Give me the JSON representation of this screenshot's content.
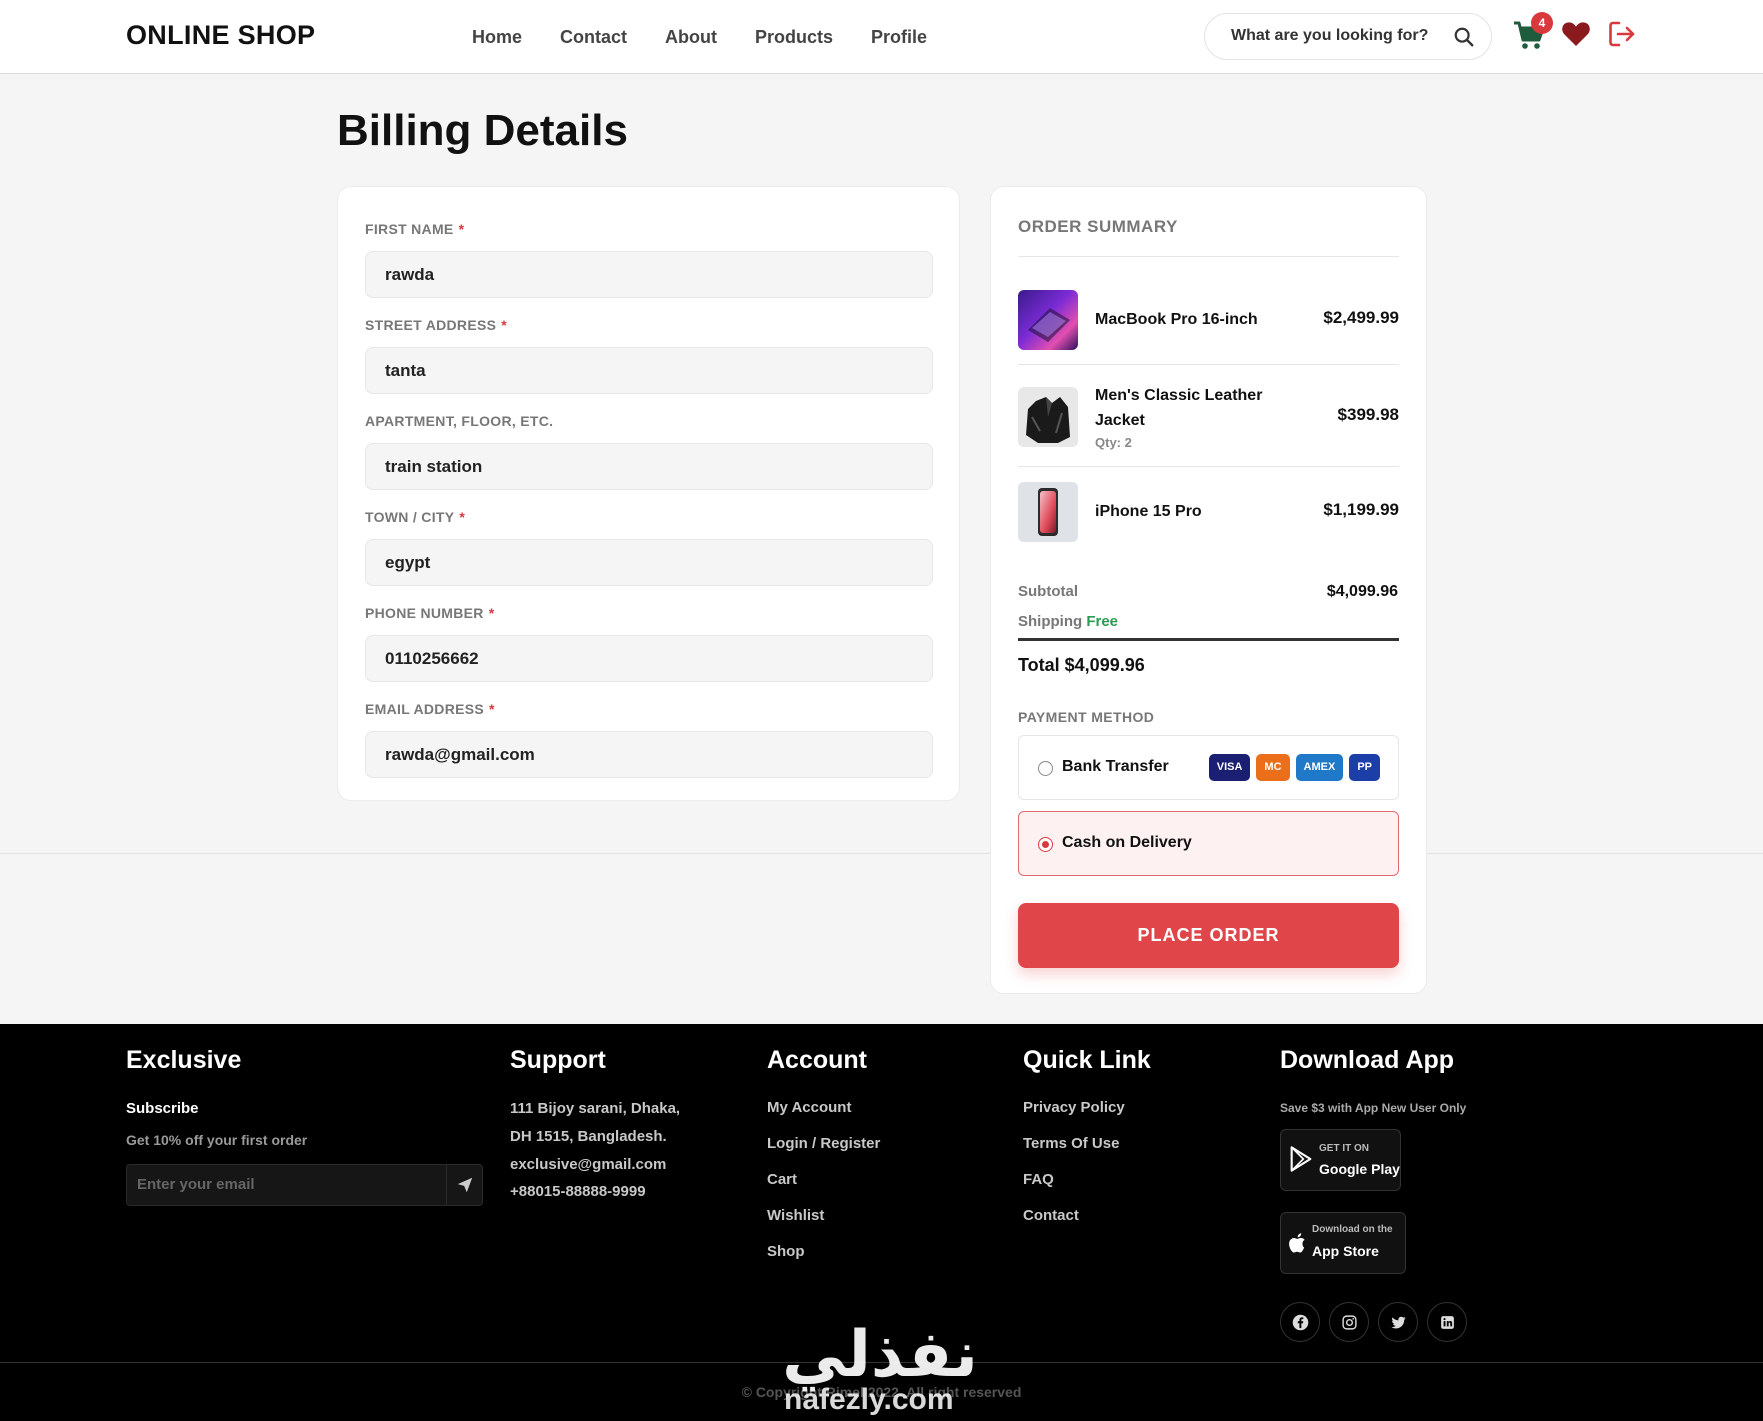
{
  "header": {
    "logo": "ONLINE SHOP",
    "nav": [
      "Home",
      "Contact",
      "About",
      "Products",
      "Profile"
    ],
    "search_placeholder": "What are you looking for?",
    "cart_count": "4"
  },
  "page_title": "Billing Details",
  "form": {
    "fields": [
      {
        "label": "FIRST NAME",
        "required": "*",
        "value": "rawda"
      },
      {
        "label": "STREET ADDRESS",
        "required": "*",
        "value": "tanta"
      },
      {
        "label": "APARTMENT, FLOOR, ETC.",
        "required": "",
        "value": "train station"
      },
      {
        "label": "TOWN / CITY",
        "required": "*",
        "value": "egypt"
      },
      {
        "label": "PHONE NUMBER",
        "required": "*",
        "value": "0110256662"
      },
      {
        "label": "EMAIL ADDRESS",
        "required": "*",
        "value": "rawda@gmail.com"
      }
    ]
  },
  "summary": {
    "title": "ORDER SUMMARY",
    "items": [
      {
        "name": "MacBook Pro 16-inch",
        "qty": "",
        "price": "$2,499.99"
      },
      {
        "name_line1": "Men's Classic Leather",
        "name_line2": "Jacket",
        "qty": "Qty: 2",
        "price": "$399.98"
      },
      {
        "name": "iPhone 15 Pro",
        "qty": "",
        "price": "$1,199.99"
      }
    ],
    "subtotal_label": "Subtotal",
    "subtotal_value": "$4,099.96",
    "shipping_label": "Shipping",
    "shipping_value": "Free",
    "total": "Total $4,099.96",
    "payment_title": "PAYMENT METHOD",
    "payment_options": [
      {
        "label": "Bank Transfer",
        "selected": false
      },
      {
        "label": "Cash on Delivery",
        "selected": true
      }
    ],
    "card_badges": [
      "VISA",
      "MC",
      "AMEX",
      "PP"
    ],
    "place_order": "PLACE ORDER"
  },
  "footer": {
    "exclusive": {
      "title": "Exclusive",
      "subscribe": "Subscribe",
      "offer": "Get 10% off your first order",
      "email_placeholder": "Enter your email"
    },
    "support": {
      "title": "Support",
      "address1": "111 Bijoy sarani, Dhaka,",
      "address2": "DH 1515, Bangladesh.",
      "email": "exclusive@gmail.com",
      "phone": "+88015-88888-9999"
    },
    "account": {
      "title": "Account",
      "links": [
        "My Account",
        "Login / Register",
        "Cart",
        "Wishlist",
        "Shop"
      ]
    },
    "quick_link": {
      "title": "Quick Link",
      "links": [
        "Privacy Policy",
        "Terms Of Use",
        "FAQ",
        "Contact"
      ]
    },
    "download": {
      "title": "Download App",
      "note": "Save $3 with App New User Only",
      "google_small": "GET IT ON",
      "google_big": "Google Play",
      "apple_small": "Download on the",
      "apple_big": "App Store"
    },
    "copyright": "© Copyright Rimel 2022. All right reserved"
  },
  "watermark": {
    "arabic": "نفذلي",
    "latin": "nafezly.com"
  },
  "colors": {
    "accent": "#df4549",
    "free": "#2a9d53",
    "footer_bg": "#000000"
  }
}
